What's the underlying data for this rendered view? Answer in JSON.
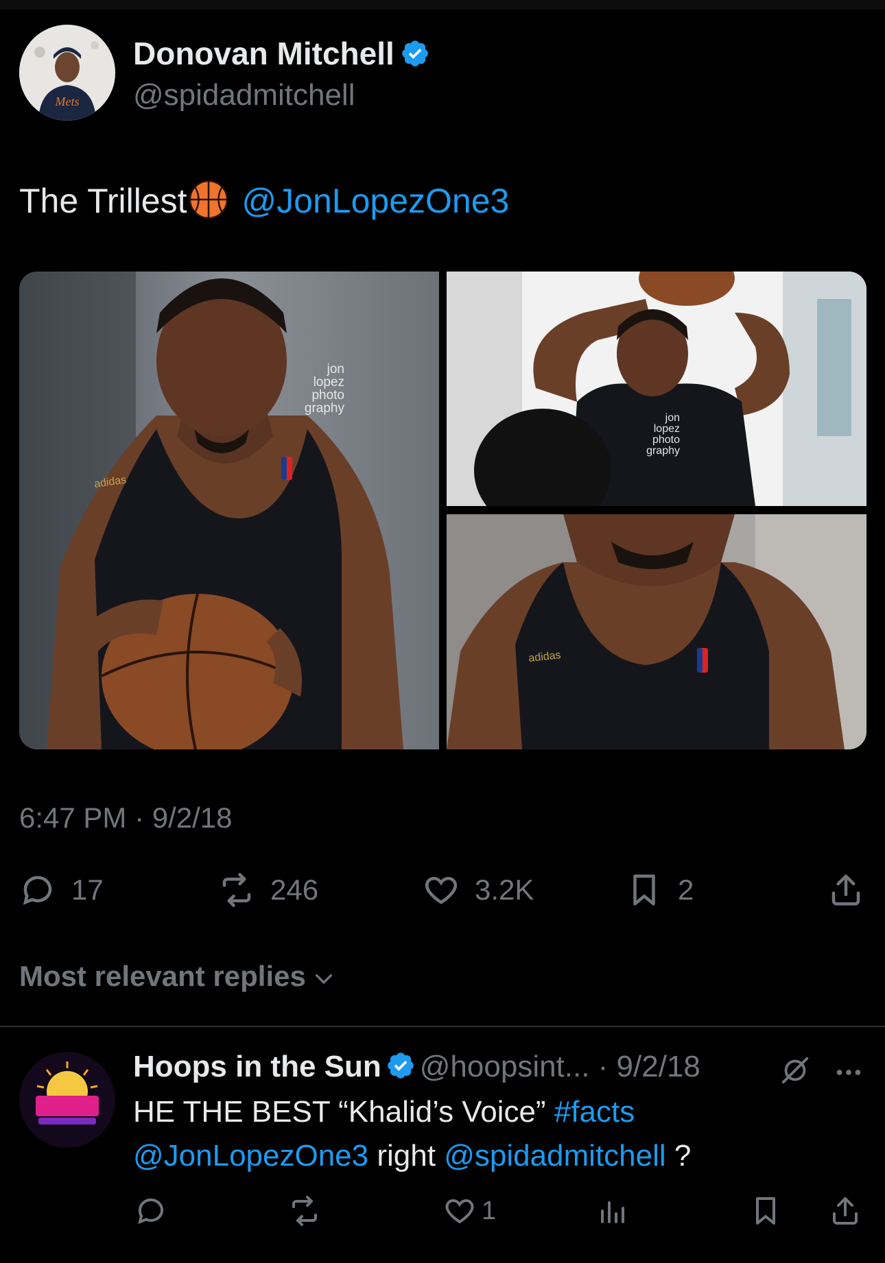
{
  "tweet": {
    "author_name": "Donovan Mitchell",
    "author_handle": "@spidadmitchell",
    "text_main": "The Trillest",
    "text_mention": "@JonLopezOne3",
    "timestamp": "6:47 PM · 9/2/18",
    "stats": {
      "replies": "17",
      "retweets": "246",
      "likes": "3.2K",
      "bookmarks": "2"
    },
    "media": {
      "watermark_lines": [
        "jon",
        "lopez",
        "photo",
        "graphy"
      ],
      "brand_text": "adidas"
    }
  },
  "replies_section": {
    "label": "Most relevant replies"
  },
  "reply": {
    "author_name": "Hoops in the Sun",
    "author_handle_date": "@hoopsint... · 9/2/18",
    "text_part1": "HE THE BEST “Khalid’s Voice” ",
    "hashtag": "#facts",
    "mention1": "@JonLopezOne3",
    "text_part2": " right ",
    "mention2": "@spidadmitchell",
    "text_part3": " ?",
    "likes": "1"
  },
  "colors": {
    "background": "#000000",
    "text": "#e7e9ea",
    "muted": "#71767b",
    "accent": "#1d9bf0"
  }
}
